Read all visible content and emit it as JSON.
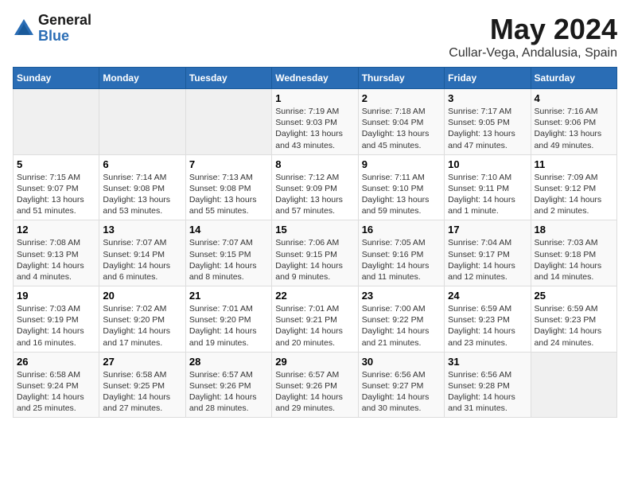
{
  "header": {
    "logo_general": "General",
    "logo_blue": "Blue",
    "main_title": "May 2024",
    "subtitle": "Cullar-Vega, Andalusia, Spain"
  },
  "calendar": {
    "days_of_week": [
      "Sunday",
      "Monday",
      "Tuesday",
      "Wednesday",
      "Thursday",
      "Friday",
      "Saturday"
    ],
    "weeks": [
      [
        {
          "day": "",
          "info": ""
        },
        {
          "day": "",
          "info": ""
        },
        {
          "day": "",
          "info": ""
        },
        {
          "day": "1",
          "info": "Sunrise: 7:19 AM\nSunset: 9:03 PM\nDaylight: 13 hours\nand 43 minutes."
        },
        {
          "day": "2",
          "info": "Sunrise: 7:18 AM\nSunset: 9:04 PM\nDaylight: 13 hours\nand 45 minutes."
        },
        {
          "day": "3",
          "info": "Sunrise: 7:17 AM\nSunset: 9:05 PM\nDaylight: 13 hours\nand 47 minutes."
        },
        {
          "day": "4",
          "info": "Sunrise: 7:16 AM\nSunset: 9:06 PM\nDaylight: 13 hours\nand 49 minutes."
        }
      ],
      [
        {
          "day": "5",
          "info": "Sunrise: 7:15 AM\nSunset: 9:07 PM\nDaylight: 13 hours\nand 51 minutes."
        },
        {
          "day": "6",
          "info": "Sunrise: 7:14 AM\nSunset: 9:08 PM\nDaylight: 13 hours\nand 53 minutes."
        },
        {
          "day": "7",
          "info": "Sunrise: 7:13 AM\nSunset: 9:08 PM\nDaylight: 13 hours\nand 55 minutes."
        },
        {
          "day": "8",
          "info": "Sunrise: 7:12 AM\nSunset: 9:09 PM\nDaylight: 13 hours\nand 57 minutes."
        },
        {
          "day": "9",
          "info": "Sunrise: 7:11 AM\nSunset: 9:10 PM\nDaylight: 13 hours\nand 59 minutes."
        },
        {
          "day": "10",
          "info": "Sunrise: 7:10 AM\nSunset: 9:11 PM\nDaylight: 14 hours\nand 1 minute."
        },
        {
          "day": "11",
          "info": "Sunrise: 7:09 AM\nSunset: 9:12 PM\nDaylight: 14 hours\nand 2 minutes."
        }
      ],
      [
        {
          "day": "12",
          "info": "Sunrise: 7:08 AM\nSunset: 9:13 PM\nDaylight: 14 hours\nand 4 minutes."
        },
        {
          "day": "13",
          "info": "Sunrise: 7:07 AM\nSunset: 9:14 PM\nDaylight: 14 hours\nand 6 minutes."
        },
        {
          "day": "14",
          "info": "Sunrise: 7:07 AM\nSunset: 9:15 PM\nDaylight: 14 hours\nand 8 minutes."
        },
        {
          "day": "15",
          "info": "Sunrise: 7:06 AM\nSunset: 9:15 PM\nDaylight: 14 hours\nand 9 minutes."
        },
        {
          "day": "16",
          "info": "Sunrise: 7:05 AM\nSunset: 9:16 PM\nDaylight: 14 hours\nand 11 minutes."
        },
        {
          "day": "17",
          "info": "Sunrise: 7:04 AM\nSunset: 9:17 PM\nDaylight: 14 hours\nand 12 minutes."
        },
        {
          "day": "18",
          "info": "Sunrise: 7:03 AM\nSunset: 9:18 PM\nDaylight: 14 hours\nand 14 minutes."
        }
      ],
      [
        {
          "day": "19",
          "info": "Sunrise: 7:03 AM\nSunset: 9:19 PM\nDaylight: 14 hours\nand 16 minutes."
        },
        {
          "day": "20",
          "info": "Sunrise: 7:02 AM\nSunset: 9:20 PM\nDaylight: 14 hours\nand 17 minutes."
        },
        {
          "day": "21",
          "info": "Sunrise: 7:01 AM\nSunset: 9:20 PM\nDaylight: 14 hours\nand 19 minutes."
        },
        {
          "day": "22",
          "info": "Sunrise: 7:01 AM\nSunset: 9:21 PM\nDaylight: 14 hours\nand 20 minutes."
        },
        {
          "day": "23",
          "info": "Sunrise: 7:00 AM\nSunset: 9:22 PM\nDaylight: 14 hours\nand 21 minutes."
        },
        {
          "day": "24",
          "info": "Sunrise: 6:59 AM\nSunset: 9:23 PM\nDaylight: 14 hours\nand 23 minutes."
        },
        {
          "day": "25",
          "info": "Sunrise: 6:59 AM\nSunset: 9:23 PM\nDaylight: 14 hours\nand 24 minutes."
        }
      ],
      [
        {
          "day": "26",
          "info": "Sunrise: 6:58 AM\nSunset: 9:24 PM\nDaylight: 14 hours\nand 25 minutes."
        },
        {
          "day": "27",
          "info": "Sunrise: 6:58 AM\nSunset: 9:25 PM\nDaylight: 14 hours\nand 27 minutes."
        },
        {
          "day": "28",
          "info": "Sunrise: 6:57 AM\nSunset: 9:26 PM\nDaylight: 14 hours\nand 28 minutes."
        },
        {
          "day": "29",
          "info": "Sunrise: 6:57 AM\nSunset: 9:26 PM\nDaylight: 14 hours\nand 29 minutes."
        },
        {
          "day": "30",
          "info": "Sunrise: 6:56 AM\nSunset: 9:27 PM\nDaylight: 14 hours\nand 30 minutes."
        },
        {
          "day": "31",
          "info": "Sunrise: 6:56 AM\nSunset: 9:28 PM\nDaylight: 14 hours\nand 31 minutes."
        },
        {
          "day": "",
          "info": ""
        }
      ]
    ]
  }
}
